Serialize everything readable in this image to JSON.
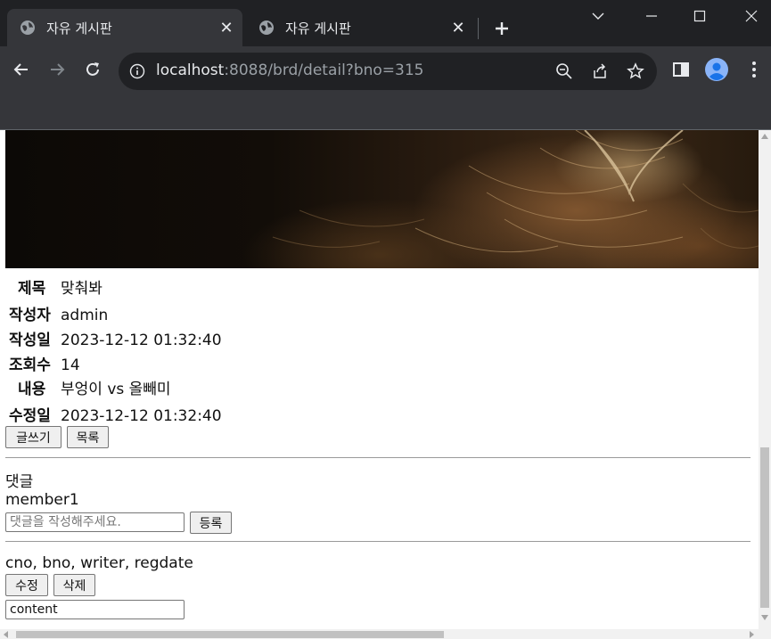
{
  "browser": {
    "tabs": [
      {
        "title": "자유 게시판",
        "active": true
      },
      {
        "title": "자유 게시판",
        "active": false
      }
    ],
    "url_host": "localhost",
    "url_path": ":8088/brd/detail?bno=315"
  },
  "post": {
    "title_label": "제목",
    "title_value": "맞춰봐",
    "writer_label": "작성자",
    "writer_value": "admin",
    "regdate_label": "작성일",
    "regdate_value": "2023-12-12 01:32:40",
    "views_label": "조회수",
    "views_value": "14",
    "content_label": "내용",
    "content_value": "부엉이 vs 올빼미",
    "moddate_label": "수정일",
    "moddate_value": "2023-12-12 01:32:40"
  },
  "actions": {
    "write_label": "글쓰기",
    "list_label": "목록"
  },
  "comments": {
    "heading": "댓글",
    "current_user": "member1",
    "input_placeholder": "댓글을 작성해주세요.",
    "submit_label": "등록",
    "item_header": "cno, bno, writer, regdate",
    "edit_label": "수정",
    "delete_label": "삭제",
    "item_content_value": "content"
  },
  "colors": {
    "tabstrip_bg": "#202124",
    "toolbar_bg": "#35363a",
    "omnibox_bg": "#202124"
  }
}
